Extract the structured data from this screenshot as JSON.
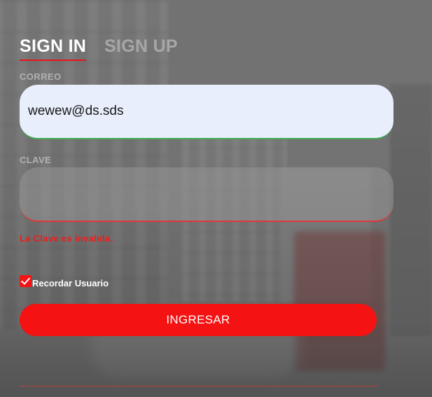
{
  "tabs": {
    "signin_label": "SIGN IN",
    "signup_label": "SIGN UP"
  },
  "email": {
    "label": "CORREO",
    "value": "wewew@ds.sds"
  },
  "password": {
    "label": "CLAVE",
    "value": "",
    "error": "La Clave es invalida."
  },
  "remember": {
    "label": "Recordar Usuario",
    "checked": true
  },
  "submit": {
    "label": "INGRESAR"
  },
  "colors": {
    "accent": "#f41212",
    "valid_border": "#3dae50",
    "error_text": "#ee1c1c"
  },
  "icons": {
    "checkbox": "check-icon"
  }
}
